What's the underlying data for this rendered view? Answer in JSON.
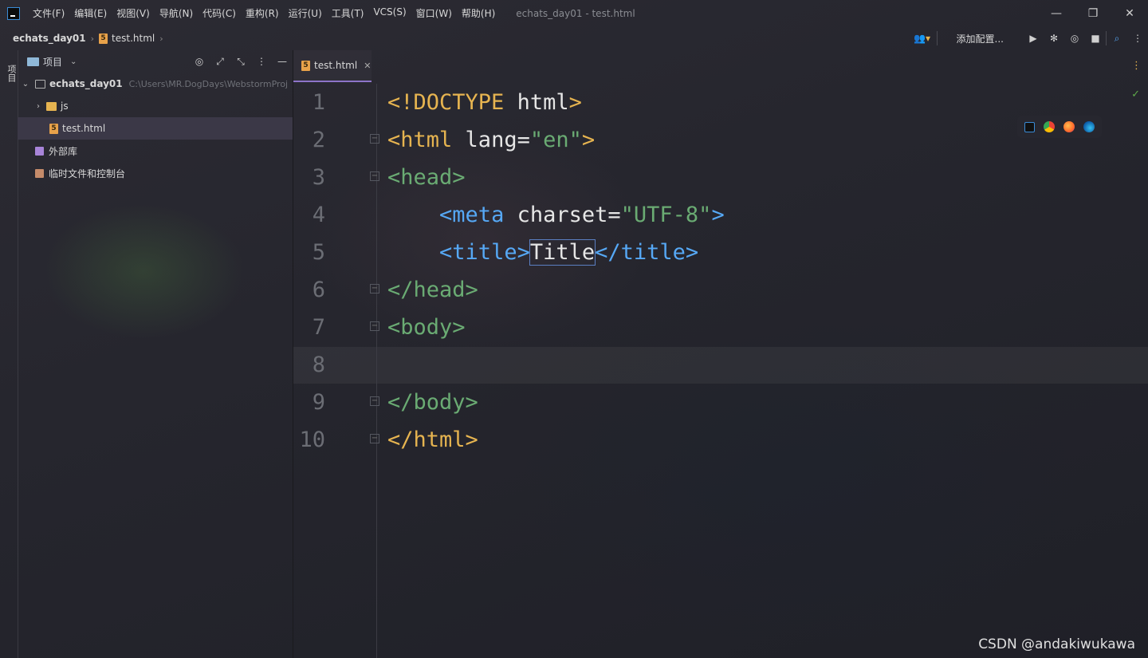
{
  "titlebar": {
    "menus": [
      "文件(F)",
      "编辑(E)",
      "视图(V)",
      "导航(N)",
      "代码(C)",
      "重构(R)",
      "运行(U)",
      "工具(T)",
      "VCS(S)",
      "窗口(W)",
      "帮助(H)"
    ],
    "window_title": "echats_day01 - test.html",
    "controls": {
      "minimize": "—",
      "restore": "❐",
      "close": "✕"
    }
  },
  "navbar": {
    "project": "echats_day01",
    "file": "test.html",
    "add_config": "添加配置..."
  },
  "toolstrip": {
    "project_tab": "项目"
  },
  "project_panel": {
    "title": "项目",
    "root_name": "echats_day01",
    "root_path": "C:\\Users\\MR.DogDays\\WebstormProj",
    "items": [
      {
        "label": "js",
        "type": "folder"
      },
      {
        "label": "test.html",
        "type": "file"
      },
      {
        "label": "外部库",
        "type": "library"
      },
      {
        "label": "临时文件和控制台",
        "type": "scratch"
      }
    ]
  },
  "editor": {
    "tab_label": "test.html",
    "line_numbers": [
      "1",
      "2",
      "3",
      "4",
      "5",
      "6",
      "7",
      "8",
      "9",
      "10"
    ],
    "code": {
      "l1_open": "<",
      "l1_doc": "!DOCTYPE",
      "l1_html": " html",
      "l1_close": ">",
      "l2_open": "<",
      "l2_tag": "html",
      "l2_attr": " lang",
      "l2_eq": "=",
      "l2_val": "\"en\"",
      "l2_close": ">",
      "l3_open": "<",
      "l3_tag": "head",
      "l3_close": ">",
      "l4_indent": "    ",
      "l4_open": "<",
      "l4_tag": "meta",
      "l4_attr": " charset",
      "l4_eq": "=",
      "l4_val": "\"UTF-8\"",
      "l4_close": ">",
      "l5_indent": "    ",
      "l5_open": "<",
      "l5_tag": "title",
      "l5_close": ">",
      "l5_text": "Title",
      "l5_end_open": "</",
      "l5_end_tag": "title",
      "l5_end_close": ">",
      "l6_open": "</",
      "l6_tag": "head",
      "l6_close": ">",
      "l7_open": "<",
      "l7_tag": "body",
      "l7_close": ">",
      "l9_open": "</",
      "l9_tag": "body",
      "l9_close": ">",
      "l10_open": "</",
      "l10_tag": "html",
      "l10_close": ">"
    }
  },
  "watermark": "CSDN @andakiwukawa",
  "colors": {
    "accent": "#8d74c9",
    "tag": "#e8c06a",
    "string": "#6aab73",
    "meta_tag": "#56a8f5"
  }
}
